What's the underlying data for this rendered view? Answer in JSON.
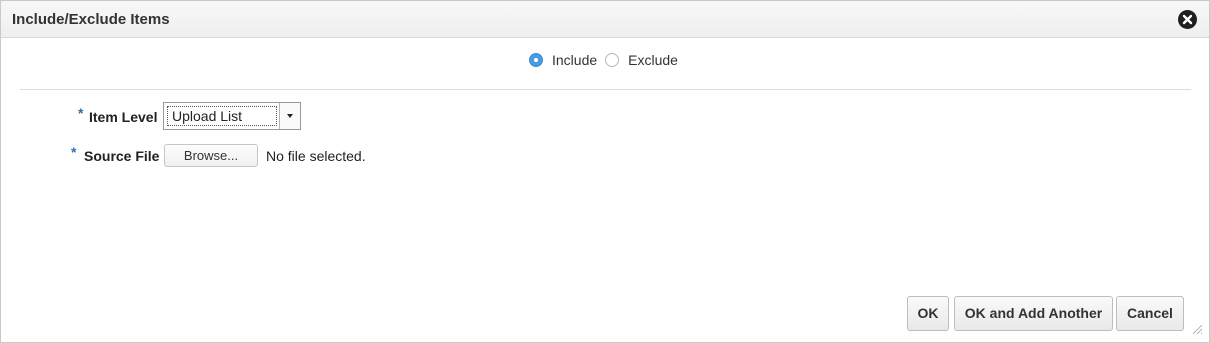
{
  "dialog": {
    "title": "Include/Exclude Items",
    "close_icon": "close-circle-icon"
  },
  "mode": {
    "options": [
      {
        "label": "Include",
        "selected": true
      },
      {
        "label": "Exclude",
        "selected": false
      }
    ]
  },
  "form": {
    "required_marker": "*",
    "item_level": {
      "label": "Item Level",
      "value": "Upload List"
    },
    "source_file": {
      "label": "Source File",
      "browse_label": "Browse...",
      "status": "No file selected."
    }
  },
  "footer": {
    "ok_label": "OK",
    "ok_add_label": "OK and Add Another",
    "cancel_label": "Cancel"
  },
  "colors": {
    "accent": "#4a9be0",
    "required": "#2f6fb0"
  }
}
